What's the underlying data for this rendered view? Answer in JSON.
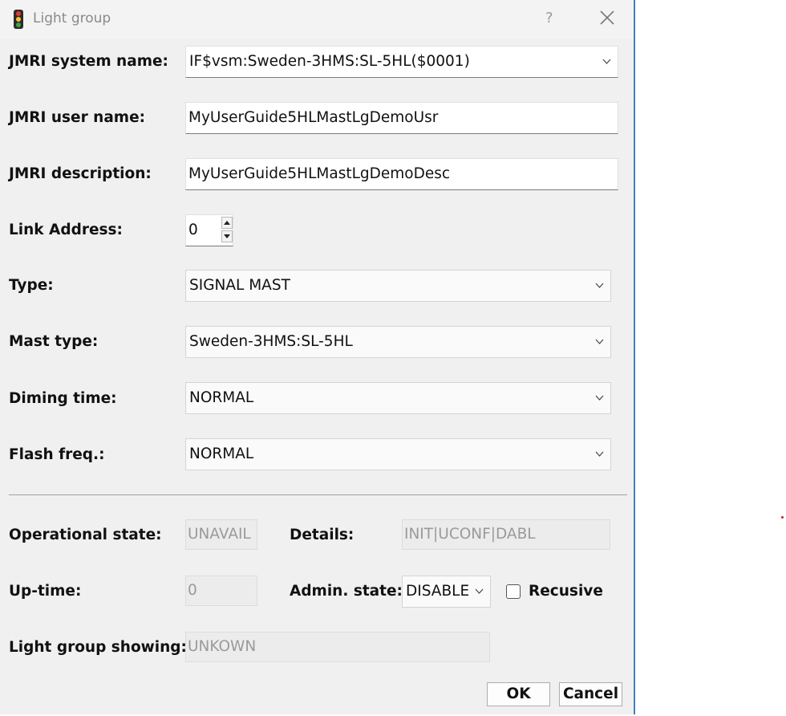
{
  "window": {
    "title": "Light group",
    "help_glyph": "?",
    "icon": "traffic-light-icon"
  },
  "form": {
    "system_name": {
      "label": "JMRI system name:",
      "value": "IF$vsm:Sweden-3HMS:SL-5HL($0001)"
    },
    "user_name": {
      "label": "JMRI user name:",
      "value": "MyUserGuide5HLMastLgDemoUsr"
    },
    "description": {
      "label": "JMRI description:",
      "value": "MyUserGuide5HLMastLgDemoDesc"
    },
    "link_address": {
      "label": "Link Address:",
      "value": "0"
    },
    "type": {
      "label": "Type:",
      "value": "SIGNAL MAST"
    },
    "mast_type": {
      "label": "Mast type:",
      "value": "Sweden-3HMS:SL-5HL"
    },
    "diming_time": {
      "label": "Diming time:",
      "value": "NORMAL"
    },
    "flash_freq": {
      "label": "Flash freq.:",
      "value": "NORMAL"
    }
  },
  "status": {
    "operational_state": {
      "label": "Operational state:",
      "value": "UNAVAIL"
    },
    "details": {
      "label": "Details:",
      "value": "INIT|UCONF|DABL"
    },
    "up_time": {
      "label": "Up-time:",
      "value": "0"
    },
    "admin_state": {
      "label": "Admin. state:",
      "value": "DISABLE"
    },
    "recursive": {
      "label": "Recusive",
      "checked": false
    },
    "light_group_showing": {
      "label": "Light group showing:",
      "value": "UNKOWN"
    }
  },
  "buttons": {
    "ok": "OK",
    "cancel": "Cancel"
  },
  "colors": {
    "window_border": "#3f7fc0",
    "dialog_bg": "#f0f0f0",
    "disabled_text": "#9a9a9a"
  }
}
